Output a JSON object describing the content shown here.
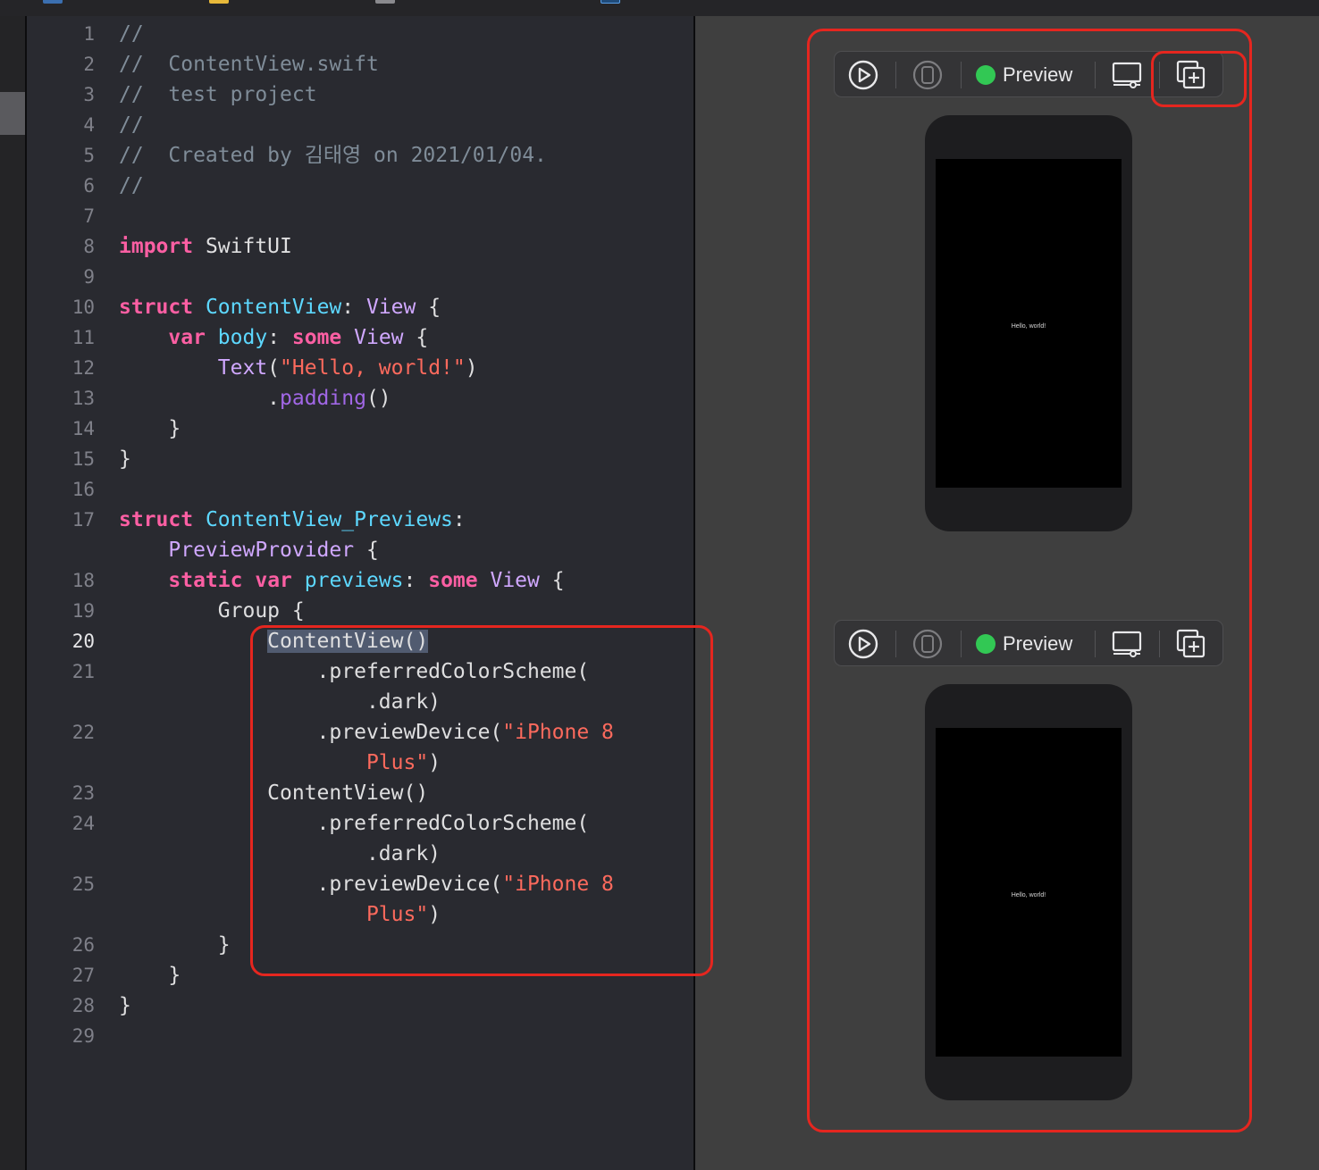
{
  "editor": {
    "lines": [
      {
        "n": "1",
        "tokens": [
          {
            "t": "//",
            "c": "cm"
          }
        ]
      },
      {
        "n": "2",
        "tokens": [
          {
            "t": "//  ContentView.swift",
            "c": "cm"
          }
        ]
      },
      {
        "n": "3",
        "tokens": [
          {
            "t": "//  test project",
            "c": "cm"
          }
        ]
      },
      {
        "n": "4",
        "tokens": [
          {
            "t": "//",
            "c": "cm"
          }
        ]
      },
      {
        "n": "5",
        "tokens": [
          {
            "t": "//  Created by 김태영 on 2021/01/04.",
            "c": "cm"
          }
        ]
      },
      {
        "n": "6",
        "tokens": [
          {
            "t": "//",
            "c": "cm"
          }
        ]
      },
      {
        "n": "7",
        "tokens": []
      },
      {
        "n": "8",
        "tokens": [
          {
            "t": "import",
            "c": "kw"
          },
          {
            "t": " SwiftUI",
            "c": "pl"
          }
        ]
      },
      {
        "n": "9",
        "tokens": []
      },
      {
        "n": "10",
        "tokens": [
          {
            "t": "struct",
            "c": "kw"
          },
          {
            "t": " ",
            "c": "pl"
          },
          {
            "t": "ContentView",
            "c": "ty"
          },
          {
            "t": ": ",
            "c": "pl"
          },
          {
            "t": "View",
            "c": "tp"
          },
          {
            "t": " {",
            "c": "pl"
          }
        ]
      },
      {
        "n": "11",
        "tokens": [
          {
            "t": "    ",
            "c": "pl"
          },
          {
            "t": "var",
            "c": "kw"
          },
          {
            "t": " ",
            "c": "pl"
          },
          {
            "t": "body",
            "c": "ty"
          },
          {
            "t": ": ",
            "c": "pl"
          },
          {
            "t": "some",
            "c": "kw"
          },
          {
            "t": " ",
            "c": "pl"
          },
          {
            "t": "View",
            "c": "tp"
          },
          {
            "t": " {",
            "c": "pl"
          }
        ]
      },
      {
        "n": "12",
        "tokens": [
          {
            "t": "        ",
            "c": "pl"
          },
          {
            "t": "Text",
            "c": "tp"
          },
          {
            "t": "(",
            "c": "pl"
          },
          {
            "t": "\"Hello, world!\"",
            "c": "st"
          },
          {
            "t": ")",
            "c": "pl"
          }
        ]
      },
      {
        "n": "13",
        "tokens": [
          {
            "t": "            .",
            "c": "pl"
          },
          {
            "t": "padding",
            "c": "fn"
          },
          {
            "t": "()",
            "c": "pl"
          }
        ]
      },
      {
        "n": "14",
        "tokens": [
          {
            "t": "    }",
            "c": "pl"
          }
        ]
      },
      {
        "n": "15",
        "tokens": [
          {
            "t": "}",
            "c": "pl"
          }
        ]
      },
      {
        "n": "16",
        "tokens": []
      },
      {
        "n": "17",
        "tokens": [
          {
            "t": "struct",
            "c": "kw"
          },
          {
            "t": " ",
            "c": "pl"
          },
          {
            "t": "ContentView_Previews",
            "c": "ty"
          },
          {
            "t": ":",
            "c": "pl"
          }
        ]
      },
      {
        "n": "",
        "tokens": [
          {
            "t": "    ",
            "c": "pl"
          },
          {
            "t": "PreviewProvider",
            "c": "tp"
          },
          {
            "t": " {",
            "c": "pl"
          }
        ]
      },
      {
        "n": "18",
        "tokens": [
          {
            "t": "    ",
            "c": "pl"
          },
          {
            "t": "static",
            "c": "kw"
          },
          {
            "t": " ",
            "c": "pl"
          },
          {
            "t": "var",
            "c": "kw"
          },
          {
            "t": " ",
            "c": "pl"
          },
          {
            "t": "previews",
            "c": "ty"
          },
          {
            "t": ": ",
            "c": "pl"
          },
          {
            "t": "some",
            "c": "kw"
          },
          {
            "t": " ",
            "c": "pl"
          },
          {
            "t": "View",
            "c": "tp"
          },
          {
            "t": " {",
            "c": "pl"
          }
        ]
      },
      {
        "n": "19",
        "tokens": [
          {
            "t": "        Group {",
            "c": "pl"
          }
        ]
      },
      {
        "n": "20",
        "current": true,
        "tokens": [
          {
            "t": "            ",
            "c": "pl"
          },
          {
            "t": "ContentView()",
            "c": "pl sel-text"
          }
        ]
      },
      {
        "n": "21",
        "tokens": [
          {
            "t": "                .preferredColorScheme(",
            "c": "pl"
          }
        ]
      },
      {
        "n": "",
        "tokens": [
          {
            "t": "                    .dark)",
            "c": "pl"
          }
        ]
      },
      {
        "n": "22",
        "tokens": [
          {
            "t": "                .previewDevice(",
            "c": "pl"
          },
          {
            "t": "\"iPhone 8",
            "c": "st"
          }
        ]
      },
      {
        "n": "",
        "tokens": [
          {
            "t": "                    ",
            "c": "pl"
          },
          {
            "t": "Plus\"",
            "c": "st"
          },
          {
            "t": ")",
            "c": "pl"
          }
        ]
      },
      {
        "n": "23",
        "tokens": [
          {
            "t": "            ContentView()",
            "c": "pl"
          }
        ]
      },
      {
        "n": "24",
        "tokens": [
          {
            "t": "                .preferredColorScheme(",
            "c": "pl"
          }
        ]
      },
      {
        "n": "",
        "tokens": [
          {
            "t": "                    .dark)",
            "c": "pl"
          }
        ]
      },
      {
        "n": "25",
        "tokens": [
          {
            "t": "                .previewDevice(",
            "c": "pl"
          },
          {
            "t": "\"iPhone 8",
            "c": "st"
          }
        ]
      },
      {
        "n": "",
        "tokens": [
          {
            "t": "                    ",
            "c": "pl"
          },
          {
            "t": "Plus\"",
            "c": "st"
          },
          {
            "t": ")",
            "c": "pl"
          }
        ]
      },
      {
        "n": "26",
        "tokens": [
          {
            "t": "        }",
            "c": "pl"
          }
        ]
      },
      {
        "n": "27",
        "tokens": [
          {
            "t": "    }",
            "c": "pl"
          }
        ]
      },
      {
        "n": "28",
        "tokens": [
          {
            "t": "}",
            "c": "pl"
          }
        ]
      },
      {
        "n": "29",
        "tokens": []
      }
    ]
  },
  "previews": [
    {
      "status": "Preview",
      "status_color": "#32c854",
      "screen_text": "Hello, world!",
      "icons": [
        "live-preview-icon",
        "device-select-icon",
        "device-settings-icon",
        "duplicate-preview-icon"
      ]
    },
    {
      "status": "Preview",
      "status_color": "#32c854",
      "screen_text": "Hello, world!",
      "icons": [
        "live-preview-icon",
        "device-select-icon",
        "device-settings-icon",
        "duplicate-preview-icon"
      ]
    }
  ],
  "colors": {
    "annotation": "#e5261f",
    "keyword": "#fc5fa3",
    "type": "#5dd8ff",
    "string": "#fc6a5d",
    "comment": "#7f8c98"
  }
}
